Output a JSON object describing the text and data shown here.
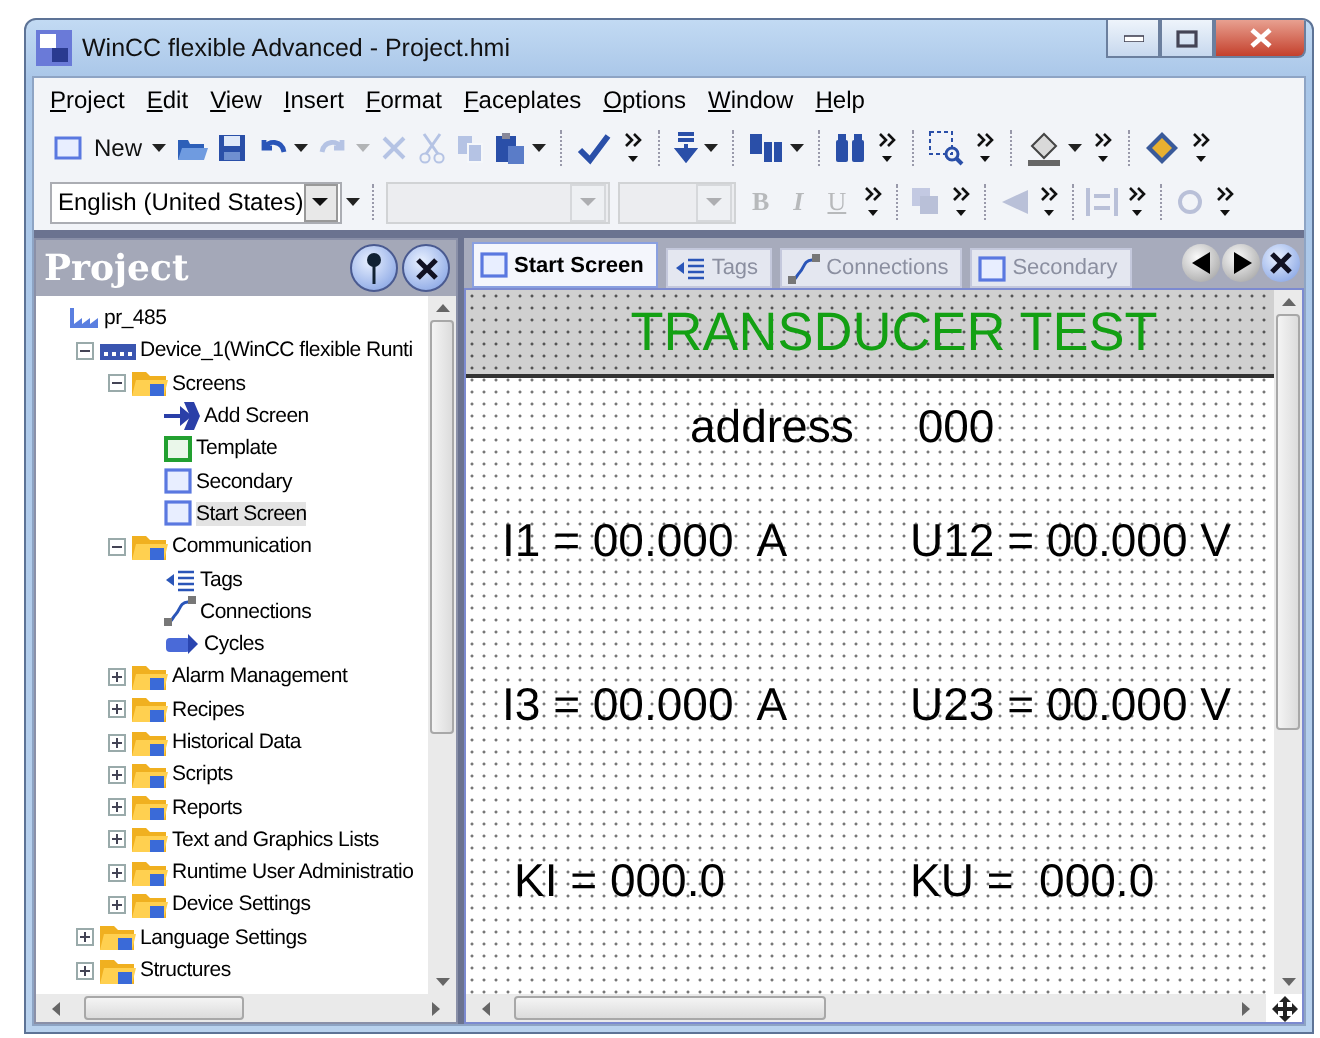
{
  "window": {
    "title": "WinCC flexible Advanced - Project.hmi"
  },
  "menu": [
    "Project",
    "Edit",
    "View",
    "Insert",
    "Format",
    "Faceplates",
    "Options",
    "Window",
    "Help"
  ],
  "toolbar": [
    {
      "kind": "new",
      "label": "New"
    },
    {
      "kind": "menu-arrow",
      "disabled": false
    },
    {
      "kind": "open"
    },
    {
      "kind": "save"
    },
    {
      "kind": "undo",
      "disabled": false
    },
    {
      "kind": "menu-arrow",
      "disabled": false
    },
    {
      "kind": "redo",
      "disabled": true
    },
    {
      "kind": "menu-arrow",
      "disabled": true
    },
    {
      "kind": "delete",
      "disabled": true
    },
    {
      "kind": "cut",
      "disabled": true
    },
    {
      "kind": "copy",
      "disabled": true
    },
    {
      "kind": "paste",
      "disabled": false
    },
    {
      "kind": "menu-arrow",
      "disabled": false
    },
    {
      "kind": "separator"
    },
    {
      "kind": "check"
    },
    {
      "kind": "overflow"
    },
    {
      "kind": "separator"
    },
    {
      "kind": "download"
    },
    {
      "kind": "menu-arrow"
    },
    {
      "kind": "separator"
    },
    {
      "kind": "devices"
    },
    {
      "kind": "menu-arrow"
    },
    {
      "kind": "separator"
    },
    {
      "kind": "binoculars"
    },
    {
      "kind": "overflow"
    },
    {
      "kind": "separator"
    },
    {
      "kind": "zoom"
    },
    {
      "kind": "overflow"
    },
    {
      "kind": "separator"
    },
    {
      "kind": "fill"
    },
    {
      "kind": "menu-arrow"
    },
    {
      "kind": "overflow"
    },
    {
      "kind": "separator"
    },
    {
      "kind": "book"
    },
    {
      "kind": "overflow"
    }
  ],
  "format_bar": [
    {
      "kind": "select",
      "value": "English (United States)",
      "disabled": false
    },
    {
      "kind": "menu-arrow"
    },
    {
      "kind": "separator"
    },
    {
      "kind": "select",
      "disabled": true
    },
    {
      "kind": "select",
      "disabled": true
    },
    {
      "kind": "text",
      "label": "B",
      "disabled": true
    },
    {
      "kind": "text",
      "label": "I",
      "disabled": true
    },
    {
      "kind": "text",
      "label": "U",
      "disabled": true
    },
    {
      "kind": "overflow"
    },
    {
      "kind": "separator"
    },
    {
      "kind": "layer",
      "disabled": true
    },
    {
      "kind": "overflow"
    },
    {
      "kind": "separator"
    },
    {
      "kind": "align",
      "disabled": true
    },
    {
      "kind": "overflow"
    },
    {
      "kind": "separator"
    },
    {
      "kind": "distribute",
      "disabled": true
    },
    {
      "kind": "overflow"
    },
    {
      "kind": "separator"
    },
    {
      "kind": "rotate",
      "disabled": true
    },
    {
      "kind": "overflow"
    }
  ],
  "project_panel": {
    "title": "Project",
    "tree": [
      {
        "label": "pr_485",
        "kind": "root",
        "selected": false,
        "children": [
          {
            "label": "Device_1(WinCC flexible Runti",
            "kind": "device",
            "selected": false,
            "expanded": true,
            "children": [
              {
                "label": "Screens",
                "kind": "folder",
                "selected": false,
                "expanded": true,
                "children": [
                  {
                    "label": "Add Screen",
                    "kind": "add",
                    "selected": false
                  },
                  {
                    "label": "Template",
                    "kind": "template",
                    "selected": false
                  },
                  {
                    "label": "Secondary",
                    "kind": "screen",
                    "selected": false
                  },
                  {
                    "label": "Start Screen",
                    "kind": "screen",
                    "selected": true
                  }
                ]
              },
              {
                "label": "Communication",
                "kind": "folder",
                "selected": false,
                "expanded": true,
                "children": [
                  {
                    "label": "Tags",
                    "kind": "tags",
                    "selected": false
                  },
                  {
                    "label": "Connections",
                    "kind": "connections",
                    "selected": false
                  },
                  {
                    "label": "Cycles",
                    "kind": "cycles",
                    "selected": false
                  }
                ]
              },
              {
                "label": "Alarm Management",
                "kind": "folder",
                "selected": false,
                "expanded": false
              },
              {
                "label": "Recipes",
                "kind": "folder",
                "selected": false,
                "expanded": false
              },
              {
                "label": "Historical Data",
                "kind": "folder",
                "selected": false,
                "expanded": false
              },
              {
                "label": "Scripts",
                "kind": "folder",
                "selected": false,
                "expanded": false
              },
              {
                "label": "Reports",
                "kind": "folder",
                "selected": false,
                "expanded": false
              },
              {
                "label": "Text and Graphics Lists",
                "kind": "folder",
                "selected": false,
                "expanded": false
              },
              {
                "label": "Runtime User Administratio",
                "kind": "folder",
                "selected": false,
                "expanded": false
              },
              {
                "label": "Device Settings",
                "kind": "folder",
                "selected": false,
                "expanded": false
              }
            ]
          },
          {
            "label": "Language Settings",
            "kind": "folder",
            "selected": false,
            "expanded": false
          },
          {
            "label": "Structures",
            "kind": "folder",
            "selected": false,
            "expanded": false
          }
        ]
      }
    ]
  },
  "tabs": [
    {
      "label": "Start Screen",
      "kind": "screen",
      "selected": true
    },
    {
      "label": "Tags",
      "kind": "tags",
      "selected": false
    },
    {
      "label": "Connections",
      "kind": "connections",
      "selected": false
    },
    {
      "label": "Secondary",
      "kind": "screen",
      "selected": false
    }
  ],
  "screen": {
    "title": "TRANSDUCER TEST",
    "address_label": "address",
    "address_value": "000",
    "readings": [
      [
        "I1 = 00.000  A",
        "U12 = 00.000 V"
      ],
      [
        "I3 = 00.000  A",
        "U23 = 00.000 V"
      ],
      [
        "KI = 000.0",
        "KU =  000.0"
      ]
    ]
  }
}
